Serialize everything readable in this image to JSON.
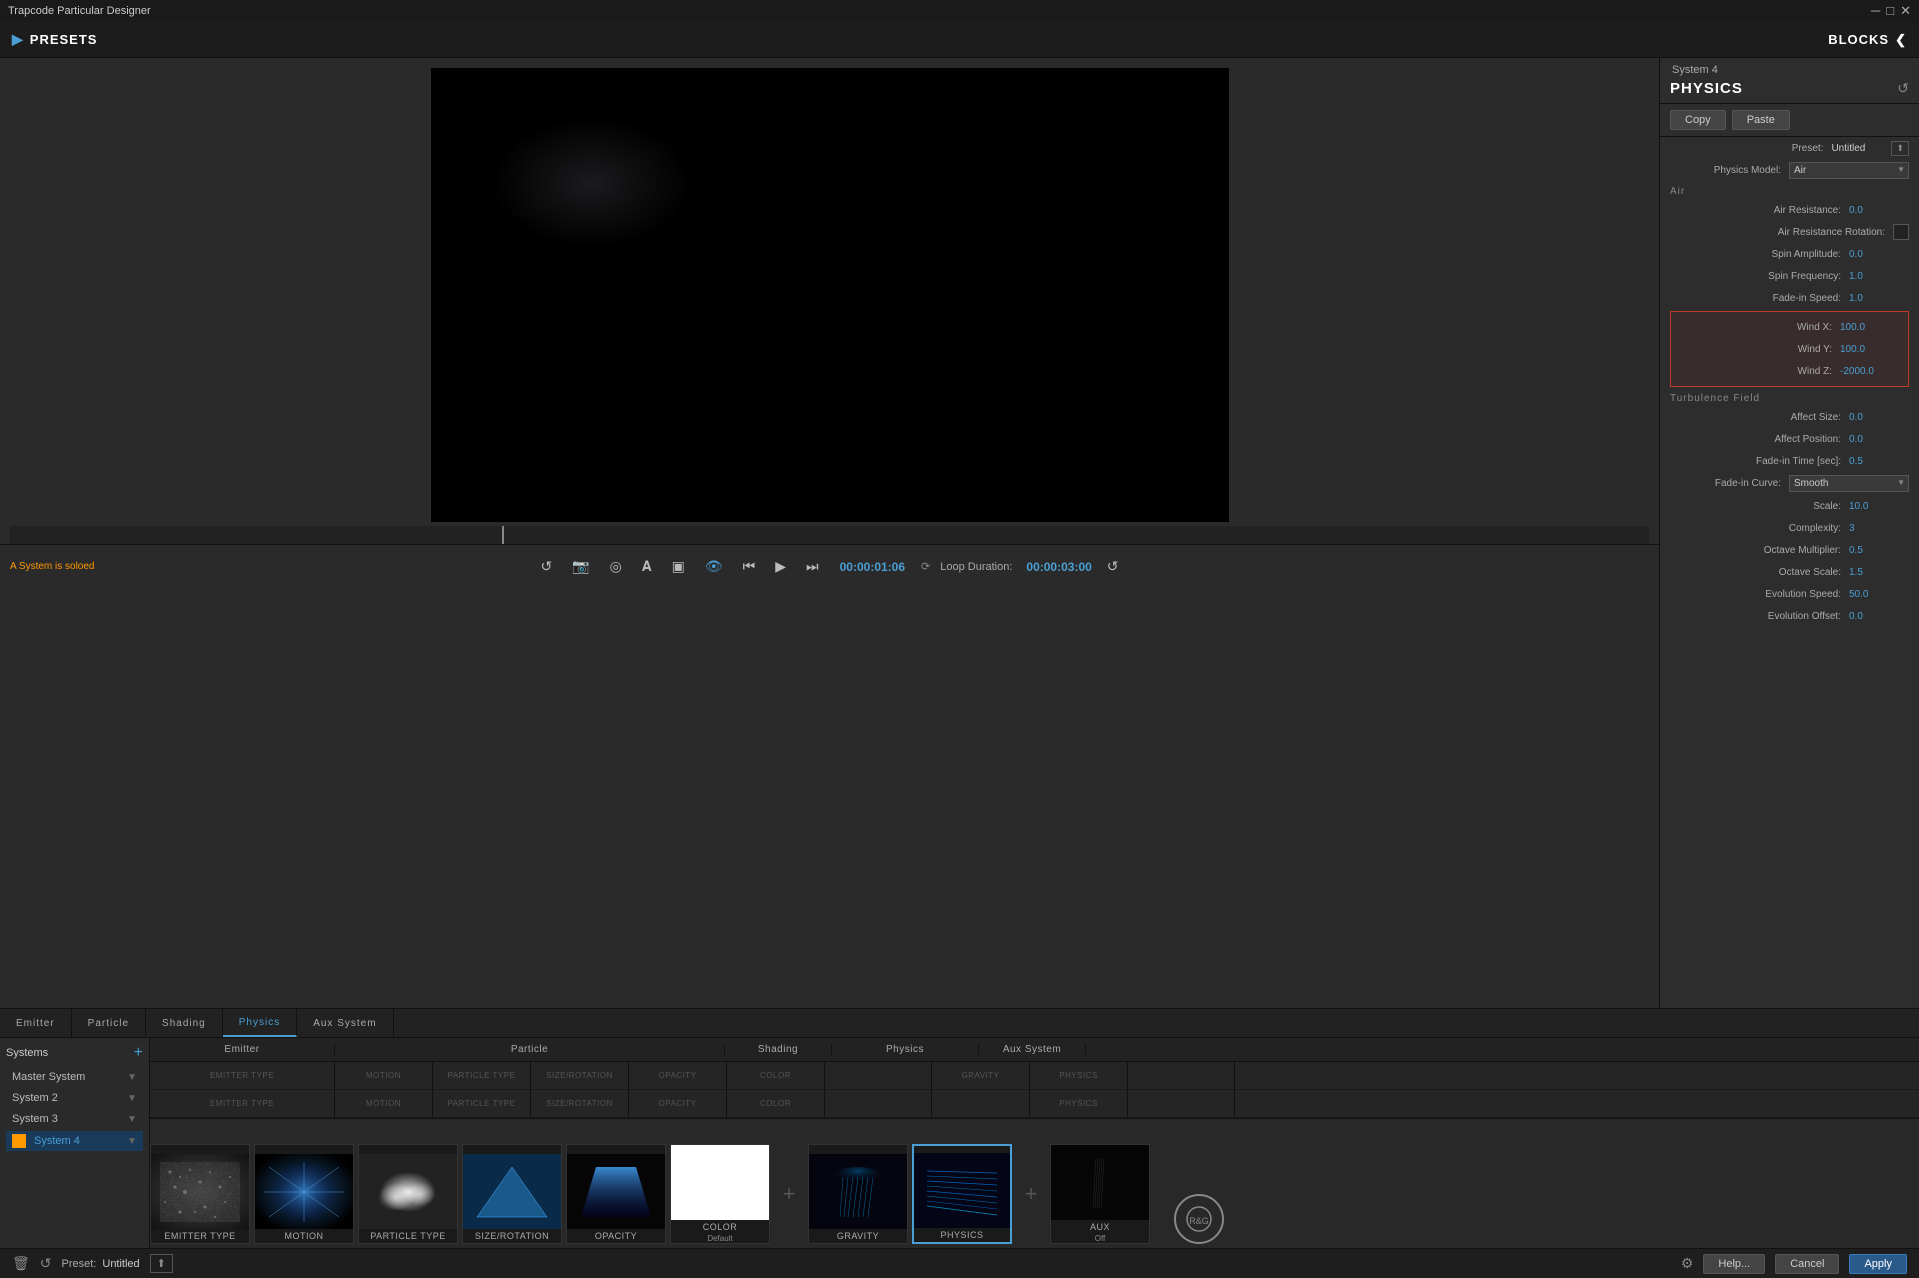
{
  "app": {
    "title": "Trapcode Particular Designer"
  },
  "titlebar": {
    "title": "Trapcode Particular Designer",
    "minimize": "─",
    "maximize": "□",
    "close": "✕"
  },
  "topbar": {
    "presets_label": "PRESETS",
    "blocks_label": "BLOCKS",
    "chevron_right": "❯",
    "chevron_left": "❮"
  },
  "right_panel": {
    "system_label": "System 4",
    "title": "PHYSICS",
    "copy_label": "Copy",
    "paste_label": "Paste",
    "preset_label": "Preset:",
    "preset_value": "Untitled",
    "physics_model_label": "Physics Model:",
    "physics_model_value": "Air",
    "section_air": "Air",
    "air_resistance_label": "Air Resistance:",
    "air_resistance_value": "0.0",
    "air_resistance_rotation_label": "Air Resistance Rotation:",
    "spin_amplitude_label": "Spin Amplitude:",
    "spin_amplitude_value": "0.0",
    "spin_frequency_label": "Spin Frequency:",
    "spin_frequency_value": "1.0",
    "fade_in_speed_label": "Fade-in Speed:",
    "fade_in_speed_value": "1.0",
    "wind_x_label": "Wind X:",
    "wind_x_value": "100.0",
    "wind_y_label": "Wind Y:",
    "wind_y_value": "100.0",
    "wind_z_label": "Wind Z:",
    "wind_z_value": "-2000.0",
    "section_turbulence": "Turbulence Field",
    "affect_size_label": "Affect Size:",
    "affect_size_value": "0.0",
    "affect_position_label": "Affect Position:",
    "affect_position_value": "0.0",
    "fade_in_time_label": "Fade-in Time [sec]:",
    "fade_in_time_value": "0.5",
    "fade_in_curve_label": "Fade-in Curve:",
    "fade_in_curve_value": "Smooth",
    "scale_label": "Scale:",
    "scale_value": "10.0",
    "complexity_label": "Complexity:",
    "complexity_value": "3",
    "octave_multiplier_label": "Octave Multiplier:",
    "octave_multiplier_value": "0.5",
    "octave_scale_label": "Octave Scale:",
    "octave_scale_value": "1.5",
    "evolution_speed_label": "Evolution Speed:",
    "evolution_speed_value": "50.0",
    "evolution_offset_label": "Evolution Offset:",
    "evolution_offset_value": "0.0"
  },
  "transport": {
    "solo_notice": "A System is soloed",
    "time": "00:00:01:06",
    "loop_duration_label": "Loop Duration:",
    "loop_duration": "00:00:03:00"
  },
  "systems": {
    "label": "Systems",
    "items": [
      {
        "name": "Master System",
        "selected": false
      },
      {
        "name": "System 2",
        "selected": false
      },
      {
        "name": "System 3",
        "selected": false
      },
      {
        "name": "System 4",
        "selected": true
      }
    ]
  },
  "bottom_tabs": [
    {
      "label": "Emitter",
      "active": false
    },
    {
      "label": "Particle",
      "active": false
    },
    {
      "label": "Shading",
      "active": false
    },
    {
      "label": "Physics",
      "active": true
    },
    {
      "label": "Aux System",
      "active": false
    }
  ],
  "track_headers": {
    "emitter": "Emitter",
    "particle": "Particle",
    "shading": "Shading",
    "physics": "Physics",
    "aux": "Aux System"
  },
  "blocks": [
    {
      "label": "EMITTER TYPE",
      "sublabel": "",
      "type": "noise"
    },
    {
      "label": "MOTION",
      "sublabel": "",
      "type": "burst"
    },
    {
      "label": "PARTICLE TYPE",
      "sublabel": "",
      "type": "cloud"
    },
    {
      "label": "SIZE/ROTATION",
      "sublabel": "",
      "type": "triangle"
    },
    {
      "label": "OPACITY",
      "sublabel": "",
      "type": "trapezoid"
    },
    {
      "label": "COLOR",
      "sublabel": "Default",
      "type": "white"
    },
    {
      "label": "GRAVITY",
      "sublabel": "",
      "type": "gravity"
    },
    {
      "label": "PHYSICS",
      "sublabel": "",
      "type": "physics",
      "selected": true
    },
    {
      "label": "AUX",
      "sublabel": "Off",
      "type": "aux"
    }
  ],
  "statusbar": {
    "preset_label": "Preset:",
    "preset_name": "Untitled",
    "help_label": "Help...",
    "cancel_label": "Cancel",
    "apply_label": "Apply"
  }
}
